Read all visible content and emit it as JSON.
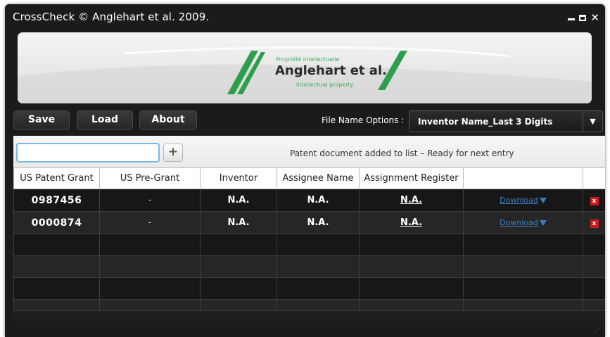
{
  "window": {
    "title": "CrossCheck  © Anglehart et al. 2009.",
    "controls": {
      "minimize_icon": "minimize-icon",
      "maximize_icon": "maximize-icon",
      "close_icon": "close-icon"
    }
  },
  "banner": {
    "tagline_fr": "Propriété intellectuelle",
    "company": "Anglehart et al.",
    "tagline_en": "Intellectual property",
    "accent_color": "#2f9e4c"
  },
  "toolbar": {
    "save_label": "Save",
    "load_label": "Load",
    "about_label": "About",
    "file_name_options_label": "File Name Options :",
    "file_name_option_selected": "Inventor Name_Last 3 Digits"
  },
  "entry": {
    "input_value": "",
    "add_symbol": "+",
    "status_message": "Patent document added to list – Ready for next entry"
  },
  "table": {
    "columns": [
      "US Patent Grant",
      "US Pre-Grant",
      "Inventor",
      "Assignee Name",
      "Assignment Register",
      "",
      ""
    ],
    "rows": [
      {
        "grant": "0987456",
        "pregrant": "-",
        "inventor": "N.A.",
        "assignee": "N.A.",
        "register": "N.A.",
        "download": "Download",
        "delete": "x"
      },
      {
        "grant": "0000874",
        "pregrant": "-",
        "inventor": "N.A.",
        "assignee": "N.A.",
        "register": "N.A.",
        "download": "Download",
        "delete": "x"
      }
    ],
    "empty_rows": 4
  },
  "colors": {
    "window_bg": "#1b1b1b",
    "link_blue": "#3b7fc4",
    "delete_red": "#c81b1b",
    "input_focus": "#7bb6ea"
  }
}
